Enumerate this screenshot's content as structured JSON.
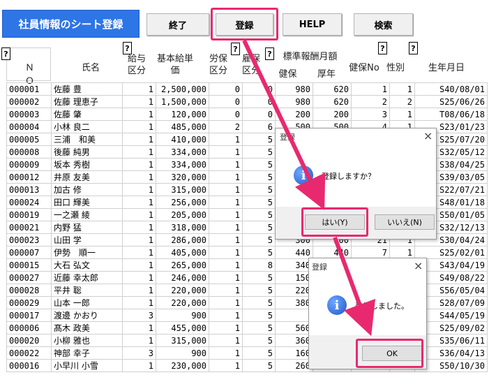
{
  "header": {
    "title": "社員情報のシート登録",
    "buttons": [
      "終了",
      "登録",
      "HELP",
      "検索"
    ]
  },
  "help_marker": "?",
  "columns": {
    "no": "ＮＯ",
    "name": "氏名",
    "pay_type": "給与区分",
    "base_pay": "基本給単価",
    "labor_ins": "労保区分",
    "emp_ins": "雇保区分",
    "std_pay": "標準報酬月額",
    "std_health": "健保",
    "std_pension": "厚年",
    "health_no": "健保No",
    "sex": "性別",
    "birth": "生年月日"
  },
  "rows": [
    [
      "000001",
      "佐藤 豊",
      "1",
      "2,500,000",
      "0",
      "0",
      "980",
      "620",
      "1",
      "1",
      "S40/08/01"
    ],
    [
      "000002",
      "佐藤 理恵子",
      "1",
      "1,500,000",
      "0",
      "0",
      "980",
      "620",
      "2",
      "2",
      "S25/06/26"
    ],
    [
      "000003",
      "佐藤 肇",
      "1",
      "120,000",
      "0",
      "0",
      "200",
      "200",
      "3",
      "1",
      "T08/06/18"
    ],
    [
      "000004",
      "小林 良二",
      "1",
      "485,000",
      "2",
      "6",
      "500",
      "500",
      "4",
      "1",
      "S23/01/23"
    ],
    [
      "000005",
      "三浦　和美",
      "1",
      "410,000",
      "1",
      "5",
      "",
      "",
      "",
      "",
      "S25/07/20"
    ],
    [
      "000008",
      "後藤 純男",
      "1",
      "334,000",
      "1",
      "5",
      "",
      "",
      "",
      "",
      "S32/05/12"
    ],
    [
      "000009",
      "坂本 秀樹",
      "1",
      "334,000",
      "1",
      "5",
      "",
      "",
      "",
      "",
      "S38/04/25"
    ],
    [
      "000012",
      "井原 友美",
      "1",
      "320,000",
      "1",
      "5",
      "",
      "",
      "",
      "",
      "S39/03/05"
    ],
    [
      "000013",
      "加古 修",
      "1",
      "315,000",
      "1",
      "5",
      "",
      "",
      "",
      "",
      "S22/07/21"
    ],
    [
      "000024",
      "田口 輝美",
      "1",
      "256,000",
      "1",
      "5",
      "",
      "",
      "",
      "",
      "S48/01/18"
    ],
    [
      "000019",
      "一之瀬 綾",
      "1",
      "205,000",
      "1",
      "5",
      "",
      "",
      "",
      "",
      "S50/01/05"
    ],
    [
      "000021",
      "内野 猛",
      "1",
      "318,000",
      "1",
      "5",
      "",
      "",
      "",
      "",
      "S32/12/13"
    ],
    [
      "000023",
      "山田 学",
      "1",
      "286,000",
      "1",
      "5",
      "300",
      "300",
      "21",
      "1",
      "S30/04/24"
    ],
    [
      "000007",
      "伊勢　順一",
      "1",
      "405,000",
      "1",
      "5",
      "440",
      "440",
      "7",
      "1",
      "S25/02/01"
    ],
    [
      "000015",
      "大石 弘文",
      "1",
      "265,000",
      "1",
      "8",
      "340",
      "",
      "",
      "",
      "S43/04/19"
    ],
    [
      "000027",
      "近藤 幸太郎",
      "1",
      "246,000",
      "1",
      "5",
      "150",
      "",
      "",
      "",
      "S49/08/22"
    ],
    [
      "000028",
      "平井 聡",
      "1",
      "220,000",
      "1",
      "5",
      "220",
      "",
      "",
      "",
      "S56/05/04"
    ],
    [
      "000029",
      "山本 一郎",
      "1",
      "220,000",
      "1",
      "5",
      "380",
      "",
      "",
      "",
      "S28/07/09"
    ],
    [
      "000017",
      "渡邊 かおり",
      "3",
      "900",
      "1",
      "5",
      "",
      "",
      "",
      "",
      "S44/05/19"
    ],
    [
      "000006",
      "髙木 政美",
      "1",
      "455,000",
      "1",
      "5",
      "560",
      "",
      "",
      "",
      "S25/09/02"
    ],
    [
      "000020",
      "小柳 雅也",
      "1",
      "315,000",
      "1",
      "5",
      "360",
      "",
      "",
      "",
      "S35/06/11"
    ],
    [
      "000022",
      "神部 幸子",
      "3",
      "900",
      "1",
      "5",
      "160",
      "",
      "",
      "",
      "S36/04/13"
    ],
    [
      "000016",
      "小早川 小雪",
      "1",
      "230,000",
      "1",
      "5",
      "260",
      "",
      "",
      "",
      "S50/10/30"
    ]
  ],
  "confirm_dialog": {
    "title": "登録",
    "message": "登録しますか？",
    "yes": "はい(Y)",
    "no": "いいえ(N)"
  },
  "done_dialog": {
    "title": "登録",
    "message": "登録しました。",
    "ok": "OK"
  },
  "colors": {
    "accent": "#2e75e6",
    "highlight": "#e8296f"
  }
}
